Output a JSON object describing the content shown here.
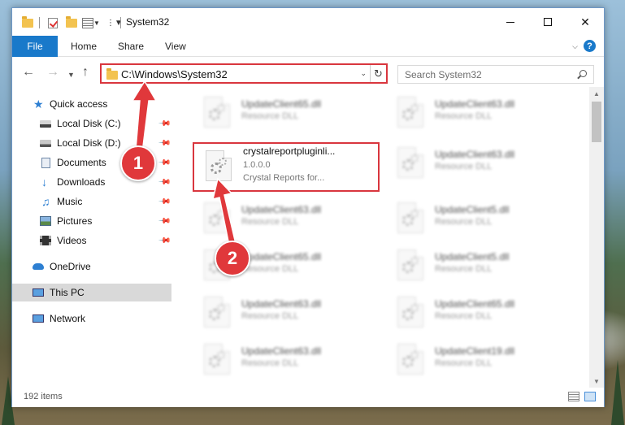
{
  "window": {
    "title": "System32"
  },
  "ribbon": {
    "tabs": [
      "File",
      "Home",
      "Share",
      "View"
    ]
  },
  "address": {
    "path": "C:\\Windows\\System32"
  },
  "search": {
    "placeholder": "Search System32"
  },
  "sidebar": {
    "items": [
      {
        "label": "Quick access",
        "icon": "star-icon"
      },
      {
        "label": "Local Disk (C:)",
        "icon": "drive-icon",
        "pinned": true
      },
      {
        "label": "Local Disk (D:)",
        "icon": "drive-icon",
        "pinned": true
      },
      {
        "label": "Documents",
        "icon": "documents-icon",
        "pinned": true
      },
      {
        "label": "Downloads",
        "icon": "download-icon",
        "pinned": true
      },
      {
        "label": "Music",
        "icon": "music-icon",
        "pinned": true
      },
      {
        "label": "Pictures",
        "icon": "pictures-icon",
        "pinned": true
      },
      {
        "label": "Videos",
        "icon": "videos-icon",
        "pinned": true
      },
      {
        "label": "OneDrive",
        "icon": "cloud-icon"
      },
      {
        "label": "This PC",
        "icon": "computer-icon",
        "selected": true
      },
      {
        "label": "Network",
        "icon": "network-icon"
      }
    ]
  },
  "files": {
    "left": [
      {
        "name": "UpdateClient65.dll",
        "type": "Resource DLL"
      },
      {
        "name": "crystalreportpluginli...",
        "version": "1.0.0.0",
        "type": "Crystal Reports for..."
      },
      {
        "name": "UpdateClient63.dll",
        "type": "Resource DLL"
      },
      {
        "name": "UpdateClient65.dll",
        "type": "Resource DLL"
      },
      {
        "name": "UpdateClient63.dll",
        "type": "Resource DLL"
      },
      {
        "name": "UpdateClient63.dll",
        "type": "Resource DLL"
      }
    ],
    "right": [
      {
        "name": "UpdateClient63.dll",
        "type": "Resource DLL"
      },
      {
        "name": "UpdateClient63.dll",
        "type": "Resource DLL"
      },
      {
        "name": "UpdateClient5.dll",
        "type": "Resource DLL"
      },
      {
        "name": "UpdateClient5.dll",
        "type": "Resource DLL"
      },
      {
        "name": "UpdateClient65.dll",
        "type": "Resource DLL"
      },
      {
        "name": "UpdateClient19.dll",
        "type": "Resource DLL"
      }
    ]
  },
  "status": {
    "count": "192 items"
  },
  "annotations": {
    "step1": "1",
    "step2": "2",
    "highlight_color": "#d9363e",
    "badge_color": "#e0383b"
  },
  "colors": {
    "accent": "#1979ca"
  }
}
